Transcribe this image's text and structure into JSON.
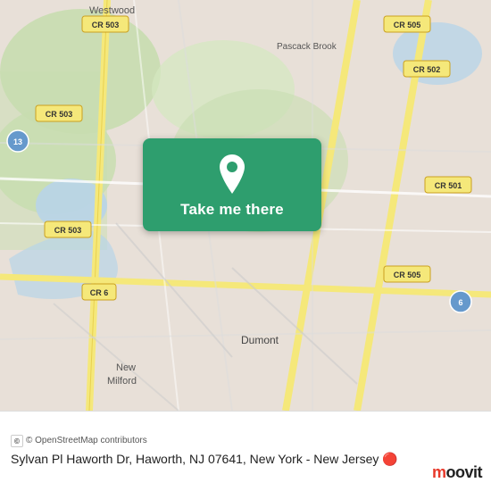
{
  "map": {
    "alt": "Map of Haworth NJ area",
    "center_lat": 40.958,
    "center_lng": -73.998
  },
  "button": {
    "label": "Take me there",
    "pin_icon": "location-pin"
  },
  "bottom_bar": {
    "osm_credit": "© OpenStreetMap contributors",
    "address": "Sylvan Pl Haworth Dr, Haworth, NJ 07641, New York - New Jersey"
  },
  "moovit": {
    "logo_text": "moovit"
  }
}
